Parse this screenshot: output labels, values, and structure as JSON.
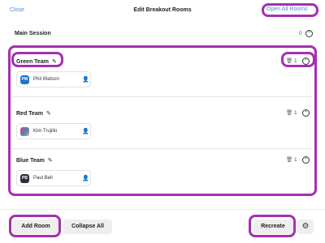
{
  "header": {
    "close_label": "Close",
    "title": "Edit Breakout Rooms",
    "open_all_label": "Open All Rooms"
  },
  "main_session": {
    "label": "Main Session",
    "count": "0"
  },
  "rooms": [
    {
      "name": "Green Team",
      "count": "1",
      "members": [
        {
          "initials": "PW",
          "name": "Phil Watson"
        }
      ]
    },
    {
      "name": "Red Team",
      "count": "1",
      "members": [
        {
          "initials": "",
          "name": "Kim Trujillo"
        }
      ]
    },
    {
      "name": "Blue Team",
      "count": "1",
      "members": [
        {
          "initials": "PB",
          "name": "Paul Bell"
        }
      ]
    }
  ],
  "footer": {
    "add_room_label": "Add Room",
    "collapse_all_label": "Collapse All",
    "recreate_label": "Recreate"
  },
  "icons": {
    "edit": "pencil-icon",
    "trash": "trash-icon",
    "collapse": "chevron-up-icon",
    "person": "person-icon",
    "settings": "gear-icon"
  },
  "colors": {
    "highlight": "#a52fb0",
    "link": "#4a8dd6",
    "avatar_blue": "#1e73c8",
    "avatar_dark": "#2d2f3a"
  }
}
